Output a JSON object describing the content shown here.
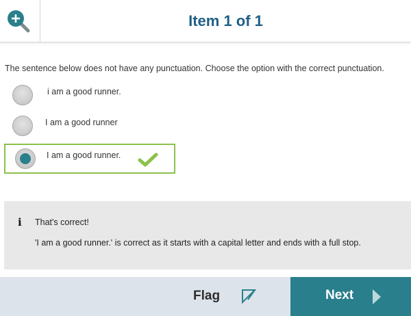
{
  "header": {
    "title": "Item 1 of 1",
    "zoom_icon": "zoom-in-magnifier-icon"
  },
  "question": {
    "instruction": "The sentence below does not have any punctuation. Choose the option with the correct punctuation.",
    "options": [
      {
        "label": "i am a good runner.",
        "selected": false
      },
      {
        "label": "I am a good runner",
        "selected": false
      },
      {
        "label": "I am a good runner.",
        "selected": true,
        "correct": true
      }
    ]
  },
  "feedback": {
    "icon": "info-icon",
    "icon_glyph": "i",
    "title": "That's correct!",
    "text": "'I am a good runner.' is correct as it starts with a capital letter and ends with a full stop."
  },
  "footer": {
    "flag_label": "Flag",
    "flag_icon": "flag-corner-icon",
    "next_label": "Next",
    "next_icon": "play-arrow-icon"
  },
  "colors": {
    "title": "#1f5f86",
    "accent": "#2a7f8c",
    "correct": "#8cc04b",
    "footer_bg": "#dde3ea",
    "feedback_bg": "#e8e8e8"
  }
}
